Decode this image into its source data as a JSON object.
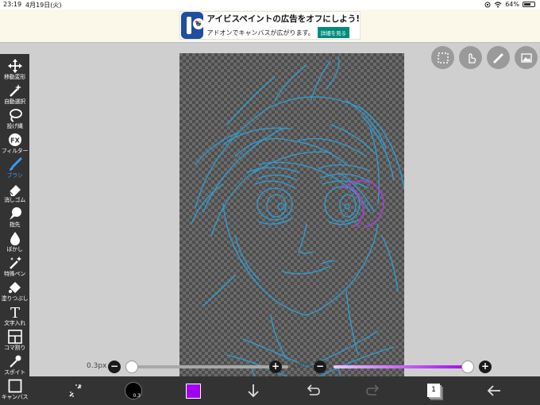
{
  "status_bar": {
    "time": "23:19",
    "date": "4月19日(火)",
    "battery": "64%",
    "battery_level": 0.64
  },
  "ad": {
    "title": "アイビスペイントの広告をオフにしよう!",
    "subtitle": "アドオンでキャンバスが広がります。",
    "cta": "詳細を見る",
    "app_letters": "iP"
  },
  "toolbar": {
    "items": [
      {
        "label": "移動変形",
        "icon": "move-transform-icon"
      },
      {
        "label": "自動選択",
        "icon": "magic-wand-icon"
      },
      {
        "label": "投げ縄",
        "icon": "lasso-icon"
      },
      {
        "label": "フィルター",
        "icon": "fx-icon",
        "glyph": "FX"
      },
      {
        "label": "ブラシ",
        "icon": "brush-icon",
        "active": true
      },
      {
        "label": "消しゴム",
        "icon": "eraser-icon"
      },
      {
        "label": "指先",
        "icon": "smudge-icon"
      },
      {
        "label": "ぼかし",
        "icon": "blur-icon"
      },
      {
        "label": "特殊ペン",
        "icon": "special-pen-icon"
      },
      {
        "label": "塗りつぶし",
        "icon": "fill-bucket-icon"
      },
      {
        "label": "文字入れ",
        "icon": "text-icon",
        "glyph": "T"
      },
      {
        "label": "コマ割り",
        "icon": "frame-divider-icon"
      },
      {
        "label": "スポイト",
        "icon": "eyedropper-icon"
      },
      {
        "label": "キャンバス",
        "icon": "canvas-icon"
      }
    ],
    "active_color": "#3d9be9"
  },
  "top_right_tools": [
    "selection-icon",
    "hand-touch-icon",
    "ruler-pen-icon",
    "image-icon"
  ],
  "sliders": {
    "brush_size": {
      "value": "0.3px",
      "fraction": 0.0
    },
    "opacity": {
      "value": "100%",
      "fraction": 1.0,
      "color": "#a100f2"
    }
  },
  "bottom_bar": {
    "brush_size_label": "0.3",
    "color": "#a100f2",
    "layer_count": "1",
    "icons": [
      "transform-icon",
      "brush-size-icon",
      "color-swatch",
      "download-icon",
      "undo-icon",
      "redo-icon",
      "layers-icon",
      "back-arrow-icon"
    ]
  },
  "canvas": {
    "sketch_color": "#2d9ed6",
    "accent_stroke_color": "#b23ad9"
  }
}
